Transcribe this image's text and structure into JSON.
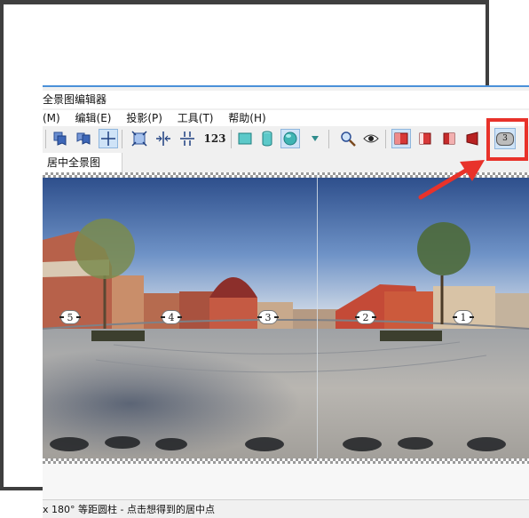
{
  "app": {
    "title": "全景图编辑器"
  },
  "menu": [
    {
      "label": "(M)"
    },
    {
      "label": "编辑(E)"
    },
    {
      "label": "投影(P)"
    },
    {
      "label": "工具(T)"
    },
    {
      "label": "帮助(H)"
    }
  ],
  "toolbar": {
    "number_button_label": "123"
  },
  "tabs": [
    {
      "label": "居中全景图"
    }
  ],
  "hotspots": [
    "5",
    "4",
    "3",
    "2",
    "1"
  ],
  "highlighted_button": {
    "label": "3"
  },
  "status": {
    "text": "x 180° 等距圆柱 - 点击想得到的居中点"
  },
  "colors": {
    "accent": "#e8322a",
    "active_button": "#cfe3f7"
  }
}
